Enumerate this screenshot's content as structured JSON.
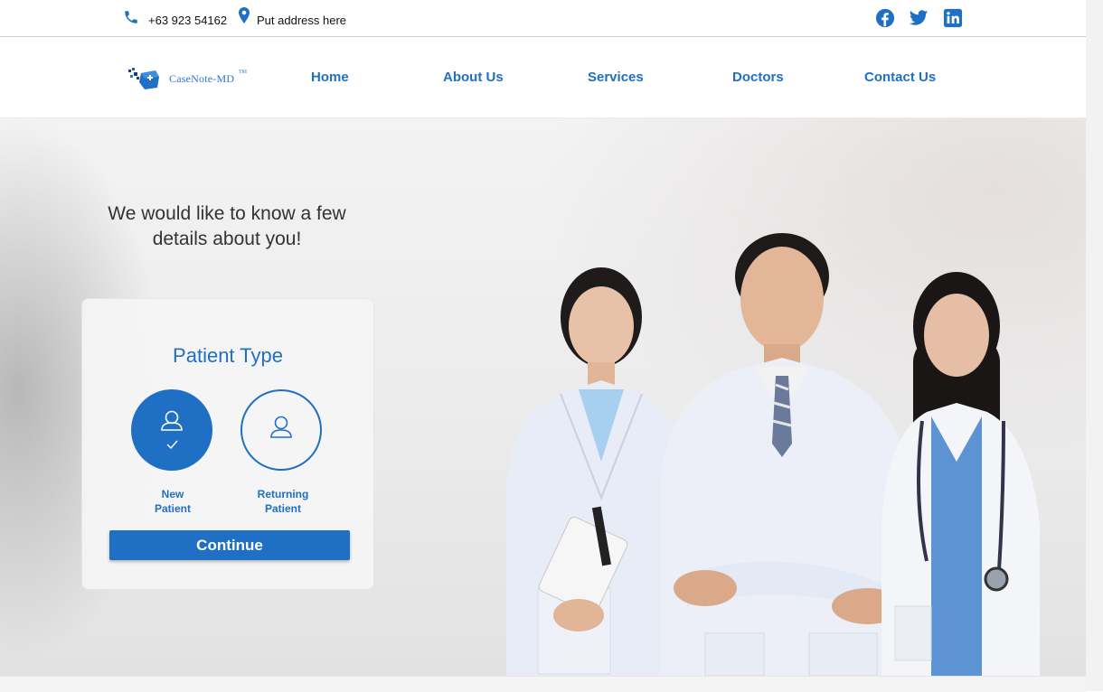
{
  "topbar": {
    "phone": "+63 923 54162",
    "address": "Put address here",
    "phone_icon": "phone-icon",
    "location_icon": "map-pin-icon",
    "social_icons": [
      "facebook-icon",
      "twitter-icon",
      "linkedin-icon"
    ]
  },
  "nav": {
    "logo_text": "CaseNote-MD",
    "logo_mark": "TM",
    "items": [
      "Home",
      "About Us",
      "Services",
      "Doctors",
      "Contact Us"
    ]
  },
  "hero": {
    "heading": "We would like to know a few details about you!",
    "card_title": "Patient Type",
    "options": [
      {
        "line1": "New",
        "line2": "Patient",
        "selected": true,
        "icon": "user-icon"
      },
      {
        "line1": "Returning",
        "line2": "Patient",
        "selected": false,
        "icon": "user-icon"
      }
    ],
    "continue_label": "Continue",
    "image": "three-doctors-photo"
  },
  "colors": {
    "primary": "#1f6fc5",
    "text": "#333333"
  }
}
